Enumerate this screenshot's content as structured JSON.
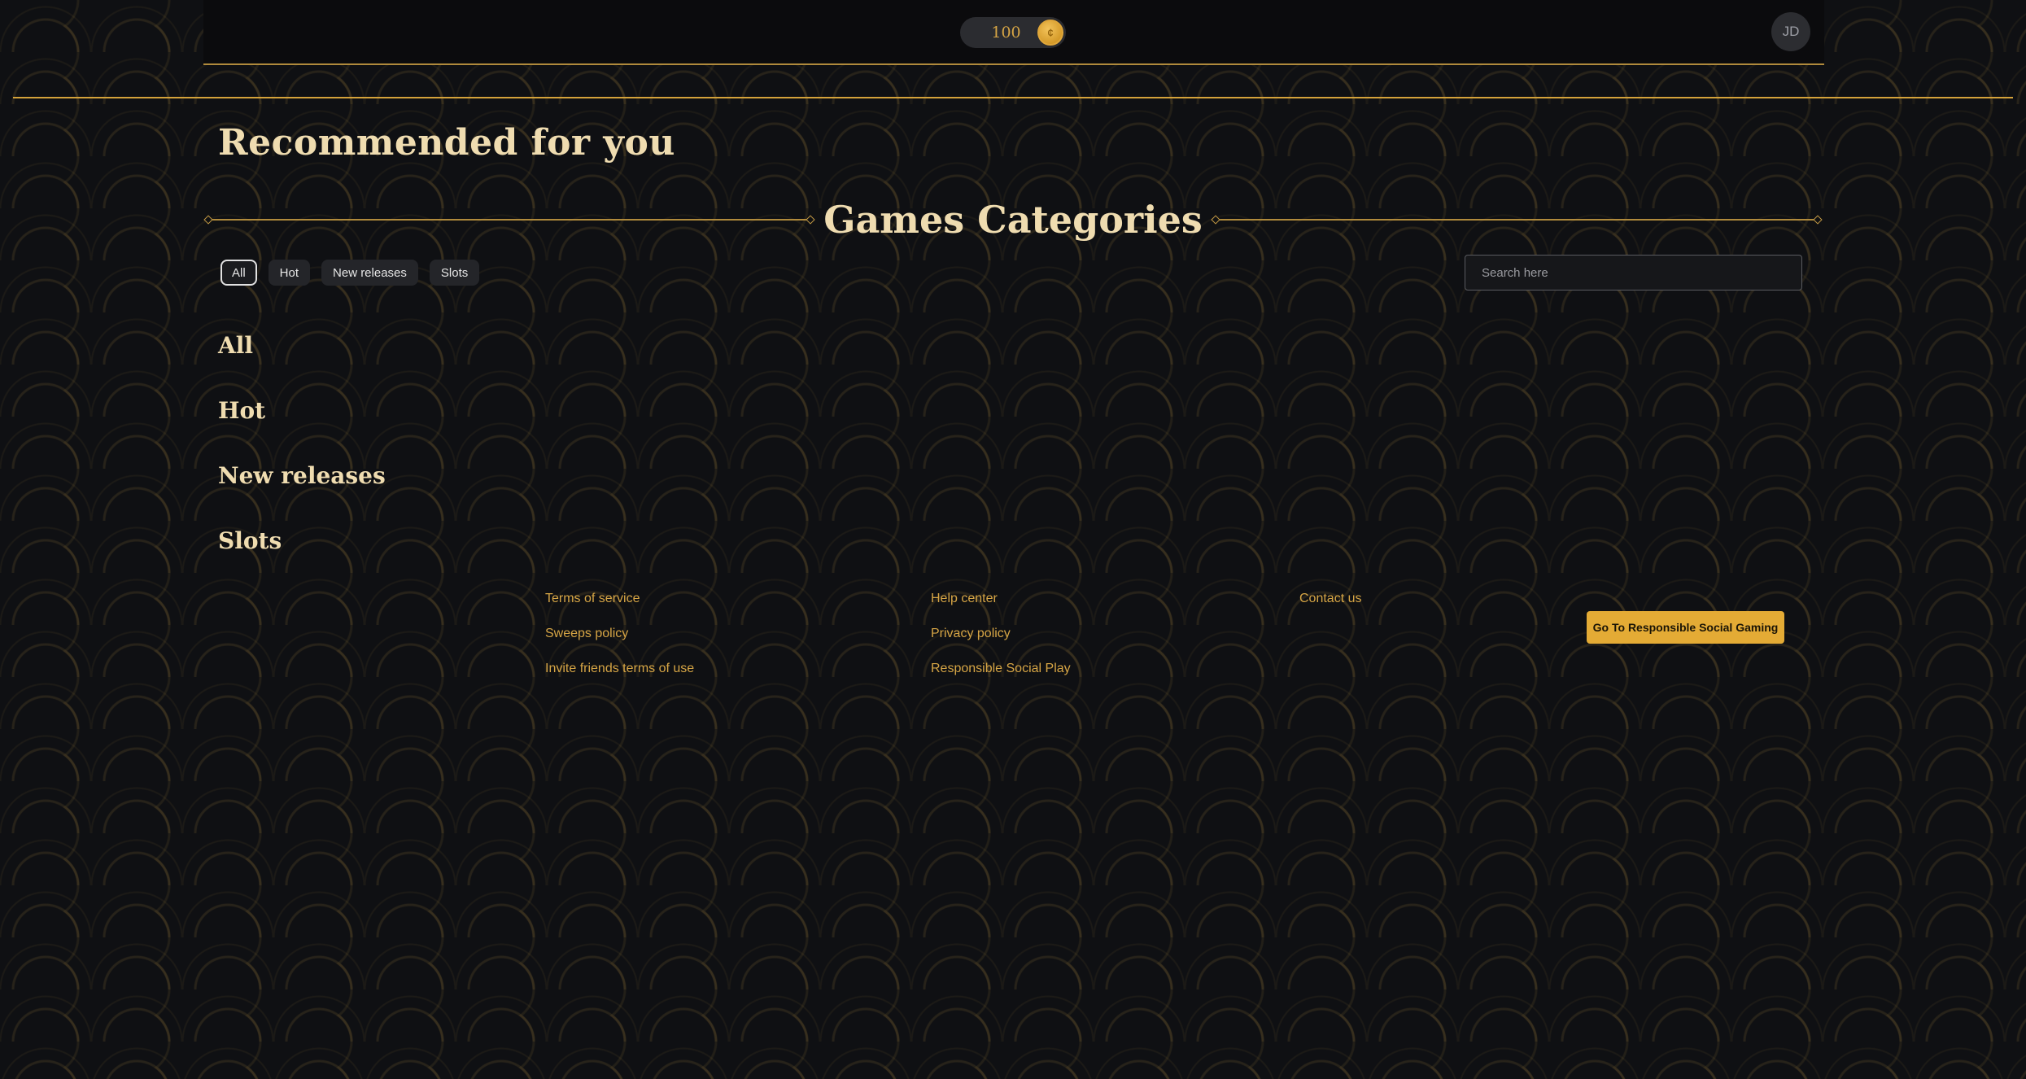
{
  "header": {
    "coin_balance": "100",
    "coin_icon": "coin-icon",
    "coin_symbol": "¢",
    "avatar_initials": "JD"
  },
  "recommended": {
    "title": "Recommended for you"
  },
  "categories": {
    "title": "Games Categories",
    "filters": [
      {
        "label": "All",
        "active": true
      },
      {
        "label": "Hot",
        "active": false
      },
      {
        "label": "New releases",
        "active": false
      },
      {
        "label": "Slots",
        "active": false
      }
    ],
    "search_placeholder": "Search here",
    "search_value": "",
    "sections": [
      "All",
      "Hot",
      "New releases",
      "Slots"
    ]
  },
  "footer": {
    "col1": [
      "Terms of service",
      "Sweeps policy",
      "Invite friends terms of use"
    ],
    "col2": [
      "Help center",
      "Privacy policy",
      "Responsible Social Play"
    ],
    "col3": [
      "Contact us"
    ],
    "cta_label": "Go To Responsible Social Gaming"
  },
  "colors": {
    "accent_gold": "#d6a545",
    "heading_cream": "#efdcb0",
    "background": "#0f1013",
    "button_gold": "#e4ab35"
  }
}
